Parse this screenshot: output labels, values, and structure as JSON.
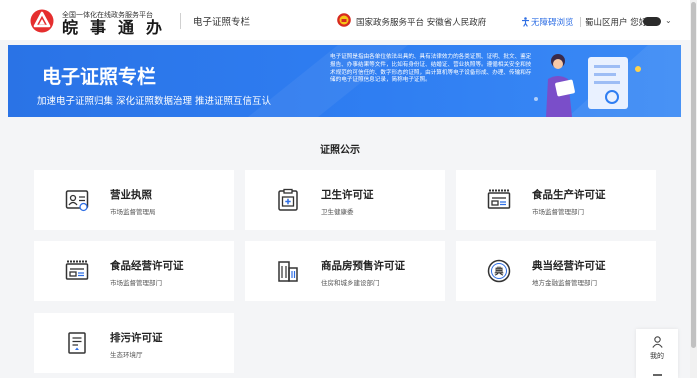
{
  "header": {
    "logo_subtitle": "全国一体化在线政务服务平台",
    "logo_title": "皖事通办",
    "section_name": "电子证照专栏",
    "gov_link": "国家政务服务平台 安徽省人民政府",
    "accessibility_link": "无障碍浏览",
    "user_greeting": "蜀山区用户 您好,",
    "brand_color": "#e52e2e",
    "link_color": "#2f6fe4"
  },
  "banner": {
    "title": "电子证照专栏",
    "subtitle": "加速电子证照归集 深化证照数据治理 推进证照互信互认",
    "description": "电子证照是指由各单位依法出具的、具有法律效力的各类证照、证明、批文、鉴定报告、办事结果等文件，比如有身份证、结婚证、营业执照等。遵循相关安全和技术规范的可信任的、数字形态的证照，由计算机等电子设备形成、办理、传输和存储的电子证照信息记录，简称电子证照。",
    "background_color": "#2f7ef2"
  },
  "section": {
    "title": "证照公示"
  },
  "cards": [
    {
      "title": "营业执照",
      "department": "市场监督管理局",
      "icon": "business-license-icon"
    },
    {
      "title": "卫生许可证",
      "department": "卫生健康委",
      "icon": "health-permit-icon"
    },
    {
      "title": "食品生产许可证",
      "department": "市场监督管理部门",
      "icon": "food-production-icon"
    },
    {
      "title": "食品经营许可证",
      "department": "市场监督管理部门",
      "icon": "food-business-icon"
    },
    {
      "title": "商品房预售许可证",
      "department": "住房和城乡建设部门",
      "icon": "building-icon"
    },
    {
      "title": "典当经营许可证",
      "department": "地方金融监督管理部门",
      "icon": "pawn-icon"
    },
    {
      "title": "排污许可证",
      "department": "生态环境厅",
      "icon": "pollution-permit-icon"
    }
  ],
  "float_panel": {
    "label": "我的"
  }
}
